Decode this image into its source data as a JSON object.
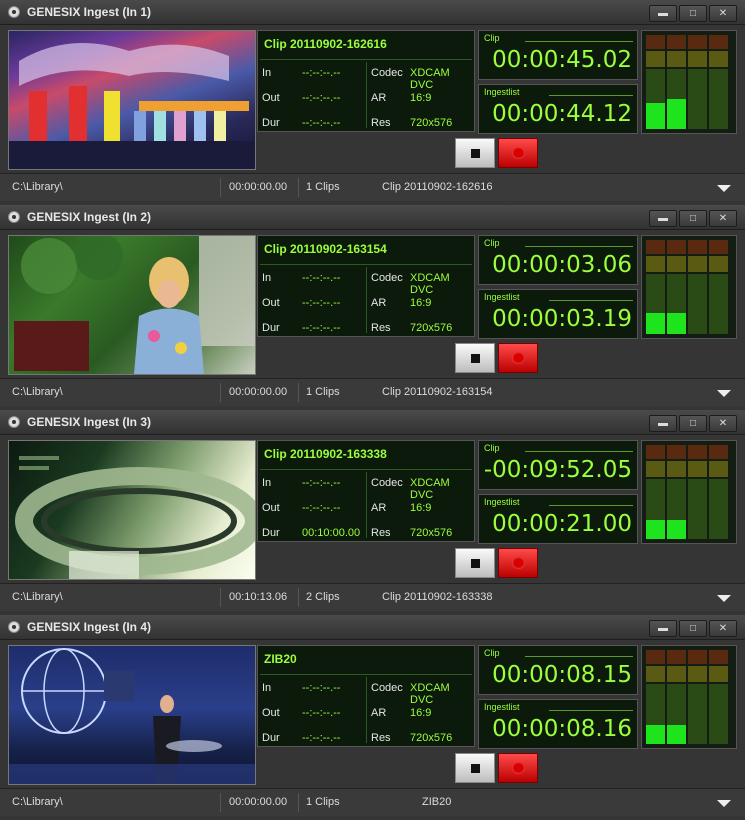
{
  "panels": [
    {
      "title": "GENESIX Ingest (In 1)",
      "clip_name": "Clip 20110902-162616",
      "in": "--:--:--.--",
      "out": "--:--:--.--",
      "dur": "--:--:--.--",
      "codec": "XDCAM DVC",
      "ar": "16:9",
      "res": "720x576",
      "clip_tc": "00:00:45.02",
      "ingestlist_tc": "00:00:44.12",
      "path": "C:\\Library\\",
      "status_time": "00:00:00.00",
      "clips_count": "1 Clips",
      "status_clip": "Clip 20110902-162616",
      "meter_levels": [
        0.28,
        0.32,
        0,
        0,
        0
      ]
    },
    {
      "title": "GENESIX Ingest (In 2)",
      "clip_name": "Clip 20110902-163154",
      "in": "--:--:--.--",
      "out": "--:--:--.--",
      "dur": "--:--:--.--",
      "codec": "XDCAM DVC",
      "ar": "16:9",
      "res": "720x576",
      "clip_tc": "00:00:03.06",
      "ingestlist_tc": "00:00:03.19",
      "path": "C:\\Library\\",
      "status_time": "00:00:00.00",
      "clips_count": "1 Clips",
      "status_clip": "Clip 20110902-163154",
      "meter_levels": [
        0.22,
        0.22,
        0,
        0,
        0
      ]
    },
    {
      "title": "GENESIX Ingest (In 3)",
      "clip_name": "Clip 20110902-163338",
      "in": "--:--:--.--",
      "out": "--:--:--.--",
      "dur": "00:10:00.00",
      "codec": "XDCAM DVC",
      "ar": "16:9",
      "res": "720x576",
      "clip_tc": "-00:09:52.05",
      "ingestlist_tc": "00:00:21.00",
      "path": "C:\\Library\\",
      "status_time": "00:10:13.06",
      "clips_count": "2 Clips",
      "status_clip": "Clip 20110902-163338",
      "meter_levels": [
        0.2,
        0.2,
        0,
        0,
        0
      ]
    },
    {
      "title": "GENESIX Ingest (In 4)",
      "clip_name": "ZIB20",
      "in": "--:--:--.--",
      "out": "--:--:--.--",
      "dur": "--:--:--.--",
      "codec": "XDCAM DVC",
      "ar": "16:9",
      "res": "720x576",
      "clip_tc": "00:00:08.15",
      "ingestlist_tc": "00:00:08.16",
      "path": "C:\\Library\\",
      "status_time": "00:00:00.00",
      "clips_count": "1 Clips",
      "status_clip": "ZIB20",
      "meter_levels": [
        0.2,
        0.2,
        0,
        0,
        0
      ]
    }
  ],
  "labels": {
    "in": "In",
    "out": "Out",
    "dur": "Dur",
    "codec": "Codec",
    "ar": "AR",
    "res": "Res",
    "clip": "Clip",
    "ingestlist": "Ingestlist"
  },
  "icons": {
    "app": "genesix-app-icon",
    "minimize": "minimize-icon",
    "maximize": "maximize-icon",
    "close": "close-icon",
    "stop": "stop-icon",
    "record": "record-icon",
    "dropdown": "chevron-down-icon"
  },
  "colors": {
    "accent": "#9bff3c",
    "record": "#e00000",
    "meter_green": "#1ee41e"
  }
}
